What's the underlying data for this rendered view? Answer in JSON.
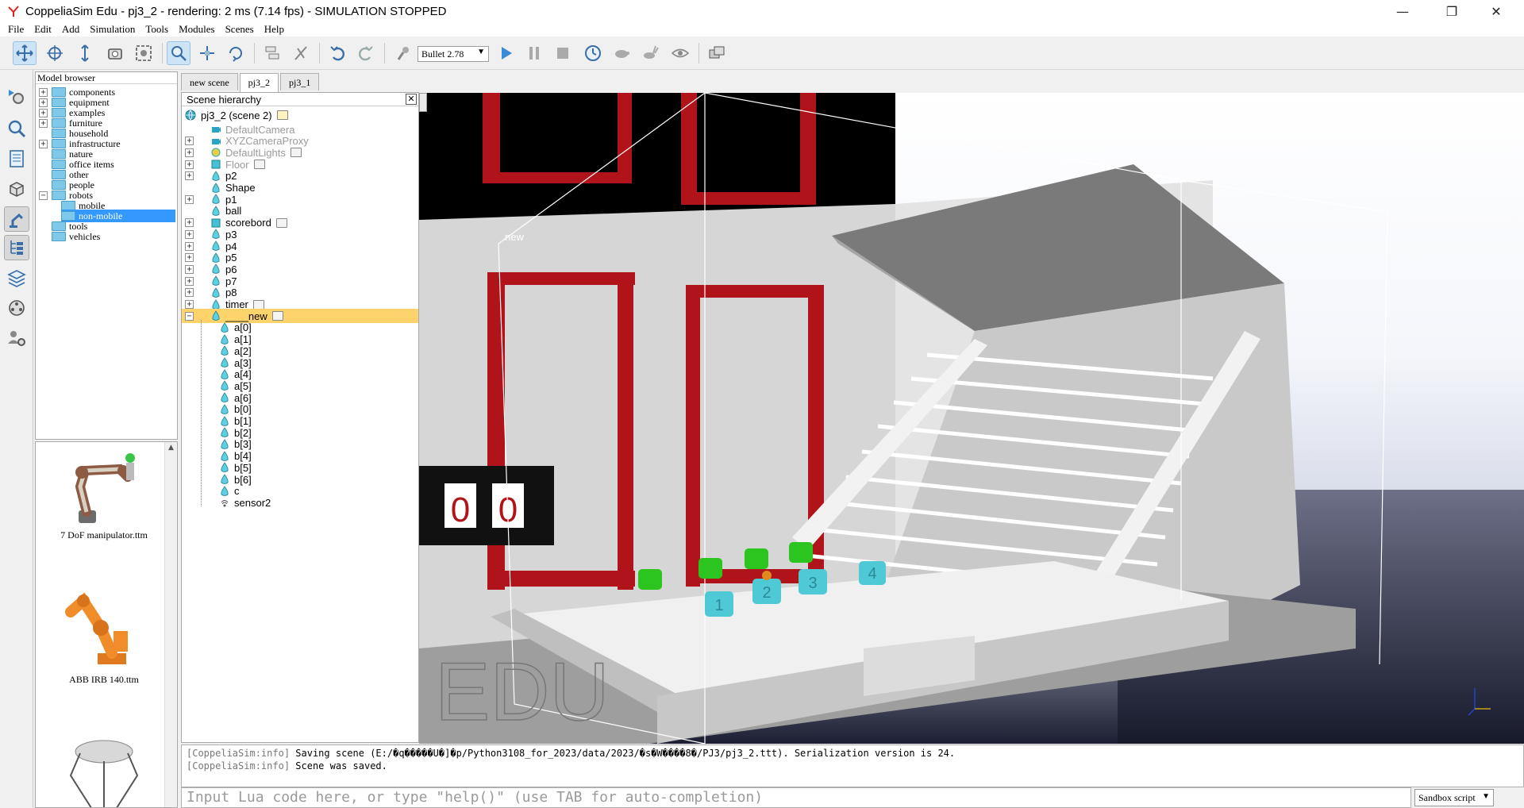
{
  "window": {
    "title": "CoppeliaSim Edu - pj3_2 - rendering: 2 ms (7.14 fps) - SIMULATION STOPPED",
    "minimize": "—",
    "restore": "❐",
    "close": "✕"
  },
  "menu": [
    "File",
    "Edit",
    "Add",
    "Simulation",
    "Tools",
    "Modules",
    "Scenes",
    "Help"
  ],
  "toolbar": {
    "engine": "Bullet 2.78"
  },
  "model_browser": {
    "title": "Model browser",
    "items": [
      {
        "label": "components",
        "expandable": true
      },
      {
        "label": "equipment",
        "expandable": true
      },
      {
        "label": "examples",
        "expandable": true
      },
      {
        "label": "furniture",
        "expandable": true
      },
      {
        "label": "household",
        "expandable": false
      },
      {
        "label": "infrastructure",
        "expandable": true
      },
      {
        "label": "nature",
        "expandable": false
      },
      {
        "label": "office items",
        "expandable": false
      },
      {
        "label": "other",
        "expandable": false
      },
      {
        "label": "people",
        "expandable": false
      },
      {
        "label": "robots",
        "expandable": true,
        "expanded": true
      },
      {
        "label": "mobile",
        "child": true
      },
      {
        "label": "non-mobile",
        "child": true,
        "selected": true
      },
      {
        "label": "tools",
        "expandable": false
      },
      {
        "label": "vehicles",
        "expandable": false
      }
    ]
  },
  "model_thumbs": [
    "7 DoF manipulator.ttm",
    "ABB IRB 140.ttm"
  ],
  "scene_tabs": [
    {
      "label": "new scene",
      "active": false
    },
    {
      "label": "pj3_2",
      "active": true
    },
    {
      "label": "pj3_1",
      "active": false
    }
  ],
  "scene_hierarchy": {
    "title": "Scene hierarchy",
    "close": "✕",
    "root": "pj3_2 (scene 2)",
    "items": [
      {
        "label": "DefaultCamera",
        "muted": true,
        "depth": 1,
        "exp": false
      },
      {
        "label": "XYZCameraProxy",
        "muted": true,
        "depth": 1,
        "exp": true
      },
      {
        "label": "DefaultLights",
        "muted": true,
        "depth": 1,
        "exp": true,
        "script": true
      },
      {
        "label": "Floor",
        "muted": true,
        "depth": 1,
        "exp": true,
        "script": true
      },
      {
        "label": "p2",
        "depth": 1,
        "exp": true
      },
      {
        "label": "Shape",
        "depth": 1,
        "exp": false
      },
      {
        "label": "p1",
        "depth": 1,
        "exp": true
      },
      {
        "label": "ball",
        "depth": 1,
        "exp": false
      },
      {
        "label": "scorebord",
        "depth": 1,
        "exp": true,
        "script": true
      },
      {
        "label": "p3",
        "depth": 1,
        "exp": true
      },
      {
        "label": "p4",
        "depth": 1,
        "exp": true
      },
      {
        "label": "p5",
        "depth": 1,
        "exp": true
      },
      {
        "label": "p6",
        "depth": 1,
        "exp": true
      },
      {
        "label": "p7",
        "depth": 1,
        "exp": true
      },
      {
        "label": "p8",
        "depth": 1,
        "exp": true
      },
      {
        "label": "timer",
        "depth": 1,
        "exp": true,
        "script": true
      },
      {
        "label": "____new",
        "depth": 1,
        "exp": true,
        "expanded": true,
        "highlight": true,
        "script": true
      },
      {
        "label": "a[0]",
        "depth": 2
      },
      {
        "label": "a[1]",
        "depth": 2
      },
      {
        "label": "a[2]",
        "depth": 2
      },
      {
        "label": "a[3]",
        "depth": 2
      },
      {
        "label": "a[4]",
        "depth": 2
      },
      {
        "label": "a[5]",
        "depth": 2
      },
      {
        "label": "a[6]",
        "depth": 2
      },
      {
        "label": "b[0]",
        "depth": 2
      },
      {
        "label": "b[1]",
        "depth": 2
      },
      {
        "label": "b[2]",
        "depth": 2
      },
      {
        "label": "b[3]",
        "depth": 2
      },
      {
        "label": "b[4]",
        "depth": 2
      },
      {
        "label": "b[5]",
        "depth": 2
      },
      {
        "label": "b[6]",
        "depth": 2
      },
      {
        "label": "c",
        "depth": 2
      },
      {
        "label": "sensor2",
        "depth": 2,
        "sensor": true
      }
    ]
  },
  "viewport": {
    "watermark": "EDU",
    "label_new": "new",
    "score_left": "0",
    "score_right": "0",
    "robot_numbers": [
      "1",
      "2",
      "3",
      "4"
    ]
  },
  "console": {
    "lines": [
      {
        "tag": "[CoppeliaSim:info]",
        "text": "Saving scene (E:/�q�����U�]�p/Python3108_for_2023/data/2023/�s�W����8�/PJ3/pj3_2.ttt). Serialization version is 24."
      },
      {
        "tag": "[CoppeliaSim:info]",
        "text": "Scene was saved."
      }
    ]
  },
  "lua_input": {
    "placeholder": "Input Lua code here, or type \"help()\" (use TAB for auto-completion)"
  },
  "script_selector": "Sandbox script",
  "colors": {
    "highlight_row": "#ffd36b",
    "selection": "#3399ff",
    "accent_blue": "#2f7fd0",
    "frame_red": "#c0181c",
    "robot_green": "#2cc41e",
    "robot_cyan": "#4fc9d6"
  }
}
